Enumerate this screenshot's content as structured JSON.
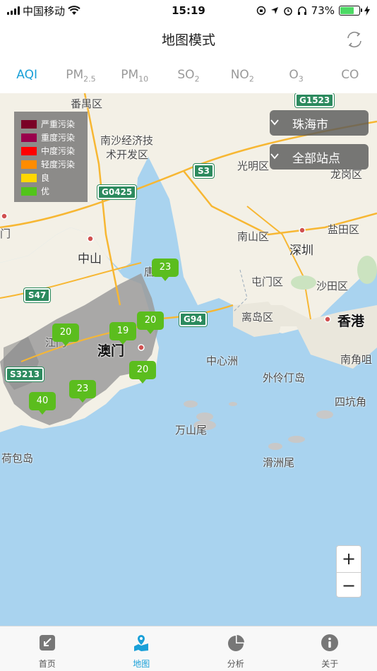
{
  "status_bar": {
    "carrier": "中国移动",
    "time": "15:19",
    "battery": "73%",
    "battery_level": 0.73
  },
  "nav": {
    "title": "地图模式"
  },
  "tabs": [
    {
      "main": "AQI",
      "sub": "",
      "active": true
    },
    {
      "main": "PM",
      "sub": "2.5",
      "active": false
    },
    {
      "main": "PM",
      "sub": "10",
      "active": false
    },
    {
      "main": "SO",
      "sub": "2",
      "active": false
    },
    {
      "main": "NO",
      "sub": "2",
      "active": false
    },
    {
      "main": "O",
      "sub": "3",
      "active": false
    },
    {
      "main": "CO",
      "sub": "",
      "active": false
    }
  ],
  "legend": [
    {
      "label": "严重污染",
      "color": "#7a0026"
    },
    {
      "label": "重度污染",
      "color": "#99004c"
    },
    {
      "label": "中度污染",
      "color": "#ff0000"
    },
    {
      "label": "轻度污染",
      "color": "#ff8c00"
    },
    {
      "label": "良",
      "color": "#ffd700"
    },
    {
      "label": "优",
      "color": "#52c41a"
    }
  ],
  "selectors": {
    "city": "珠海市",
    "station": "全部站点"
  },
  "places": {
    "panyu": "番禺区",
    "nansha": "南沙经济技",
    "nansha2": "术开发区",
    "guangming": "光明区",
    "longgang": "龙岗区",
    "yantian": "盐田区",
    "nanshan": "南山区",
    "shenzhen": "深圳",
    "zhongshan": "中山",
    "tuenmun": "屯门区",
    "shatin": "沙田区",
    "lantau": "离岛区",
    "hongkong": "香港",
    "macau": "澳门",
    "jiangmen": "江门",
    "zhongxinzhou": "中心洲",
    "wailingding": "外伶仃岛",
    "nanjiaozui": "南角咀",
    "sikengjiao": "四坑角",
    "wanshanwei": "万山尾",
    "hebaodao": "荷包岛",
    "huazhouwei": "滑洲尾",
    "tang": "唐",
    "gate": "门"
  },
  "roads": {
    "g1523": "G1523",
    "s3": "S3",
    "g0425": "G0425",
    "s47": "S47",
    "g94": "G94",
    "s3213": "S3213"
  },
  "markers": [
    {
      "value": "23"
    },
    {
      "value": "20"
    },
    {
      "value": "19"
    },
    {
      "value": "20"
    },
    {
      "value": "20"
    },
    {
      "value": "23"
    },
    {
      "value": "40"
    }
  ],
  "zoom": {
    "in": "+",
    "out": "−"
  },
  "tab_bar": [
    {
      "label": "首页",
      "icon": "home-icon",
      "active": false
    },
    {
      "label": "地图",
      "icon": "map-pin-icon",
      "active": true
    },
    {
      "label": "分析",
      "icon": "pie-chart-icon",
      "active": false
    },
    {
      "label": "关于",
      "icon": "info-icon",
      "active": false
    }
  ],
  "colors": {
    "accent": "#1aa0d8",
    "marker_good": "#5bbd1e"
  }
}
